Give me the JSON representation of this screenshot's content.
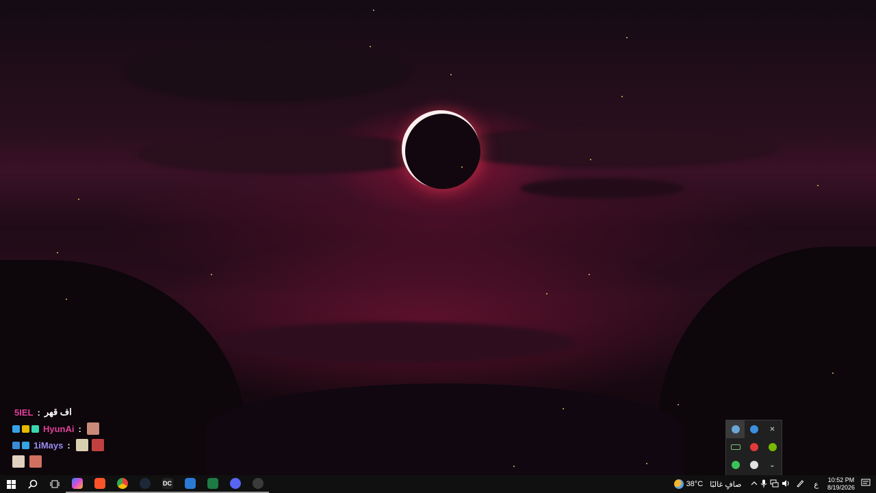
{
  "chat": [
    {
      "name": "5IEL",
      "name_color": "#e0409a",
      "message": "اف قهر",
      "badges": [],
      "emotes": []
    },
    {
      "name": "HyunAi",
      "name_color": "#e0409a",
      "message": "",
      "badges": [
        "#36a3e6",
        "#e6b800",
        "#3ad6b0"
      ],
      "emotes": [
        "#c98a7a"
      ]
    },
    {
      "name": "1iMays",
      "name_color": "#9a8cf0",
      "message": "",
      "badges": [
        "#3a8bd6",
        "#36a3e6"
      ],
      "emotes": [
        "#d9d0b0",
        "#c04040",
        "#e0d0c0",
        "#d07060"
      ]
    }
  ],
  "chat_separator": ":",
  "taskbar": {
    "apps": [
      {
        "name": "start-button",
        "label": "",
        "color": "#ffffff",
        "icon": "windows-logo"
      },
      {
        "name": "search-button",
        "label": "",
        "color": "#ffffff",
        "icon": "search-icon"
      },
      {
        "name": "task-view-button",
        "label": "",
        "color": "#ffffff",
        "icon": "task-view-icon"
      },
      {
        "name": "copilot-button",
        "label": "",
        "color": "#5b8cff",
        "icon": "copilot-icon"
      },
      {
        "name": "brave-button",
        "label": "",
        "color": "#fb542b",
        "icon": "brave-icon"
      },
      {
        "name": "chrome-button",
        "label": "",
        "color": "#34a853",
        "icon": "chrome-icon"
      },
      {
        "name": "steam-button",
        "label": "",
        "color": "#1b2838",
        "icon": "steam-icon"
      },
      {
        "name": "dc-button",
        "label": "DC",
        "color": "#222222",
        "icon": "dc-icon"
      },
      {
        "name": "editor-button",
        "label": "",
        "color": "#2a7ad6",
        "icon": "window-icon"
      },
      {
        "name": "excel-button",
        "label": "",
        "color": "#1d7a45",
        "icon": "excel-icon"
      },
      {
        "name": "discord-button",
        "label": "",
        "color": "#5865f2",
        "icon": "discord-icon"
      },
      {
        "name": "obs-button",
        "label": "",
        "color": "#3a3a3a",
        "icon": "obs-icon"
      }
    ],
    "weather": {
      "temp": "38°C",
      "desc": "صافٍ غالبًا"
    },
    "language": "ع",
    "clock": {
      "time": "10:52 PM",
      "date": "8/19/2026"
    }
  },
  "tray_popup": {
    "icons": [
      {
        "name": "tray-steam-icon",
        "color": "#6aa6d6"
      },
      {
        "name": "tray-ubisoft-icon",
        "color": "#3b8fe0"
      },
      {
        "name": "tray-close-icon",
        "color": "#cfcfcf"
      },
      {
        "name": "tray-bracket-icon",
        "color": "#7fbf7f"
      },
      {
        "name": "tray-epic-icon",
        "color": "#e03a3a"
      },
      {
        "name": "tray-nvidia-icon",
        "color": "#76b900"
      },
      {
        "name": "tray-green-dot-icon",
        "color": "#3ac25a"
      },
      {
        "name": "tray-obs-icon",
        "color": "#e0e0e0"
      },
      {
        "name": "tray-arrow-icon",
        "color": "#e0e0e0"
      }
    ]
  }
}
